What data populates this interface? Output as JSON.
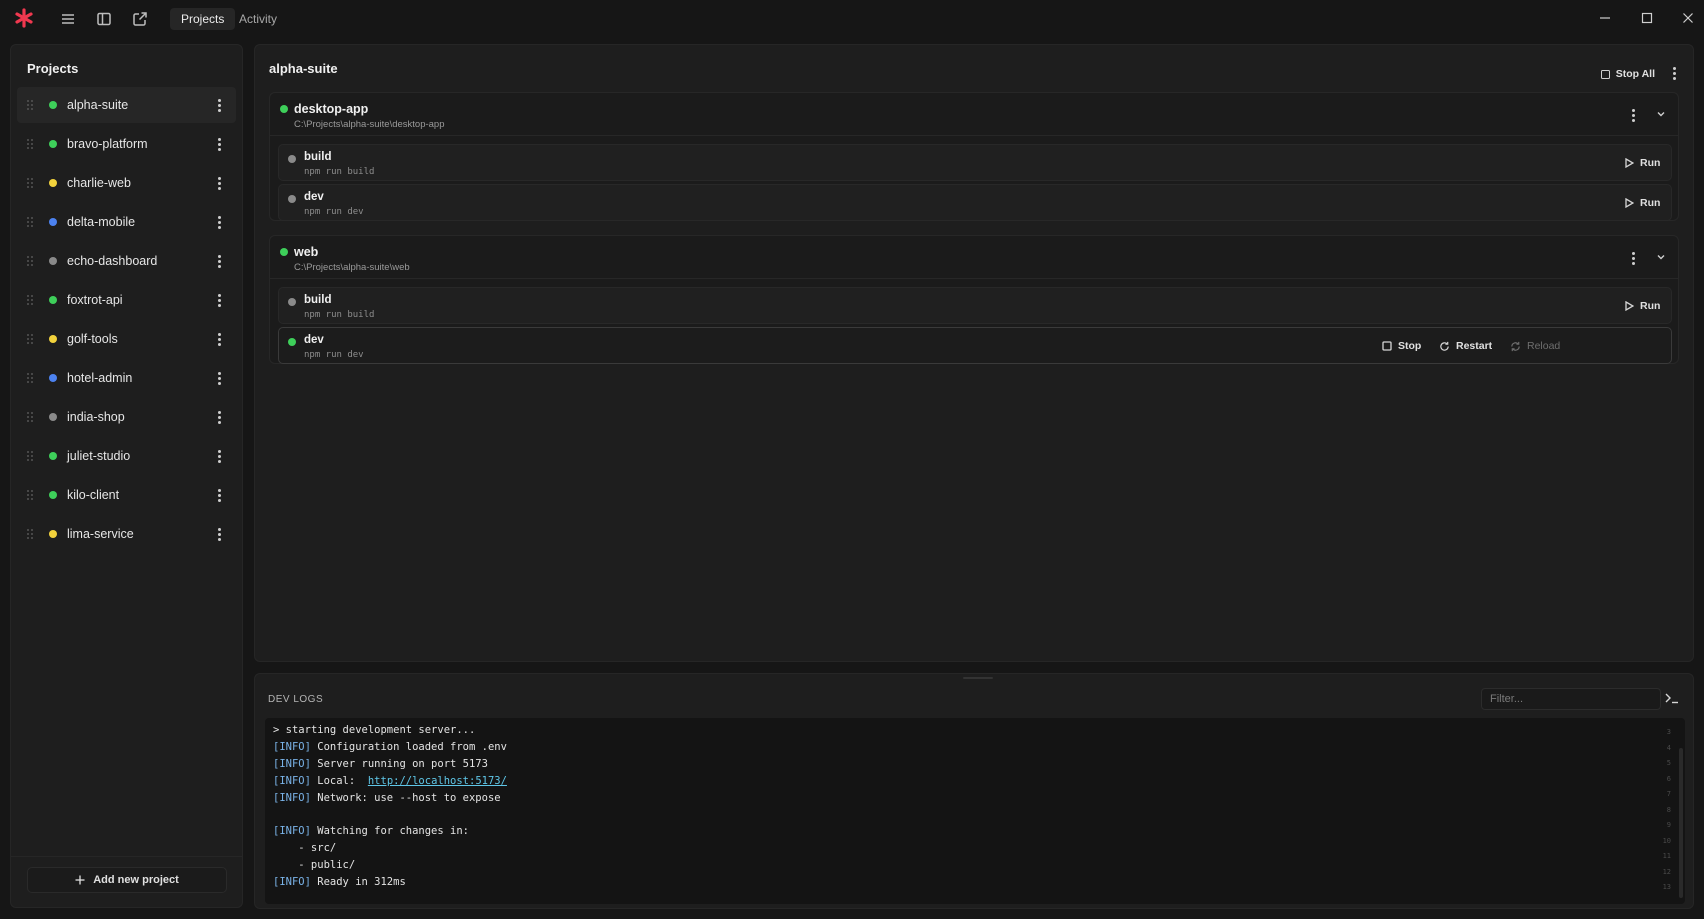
{
  "titlebar": {
    "tabs": [
      {
        "label": "Projects",
        "active": true
      },
      {
        "label": "Activity",
        "active": false
      }
    ],
    "icons": [
      "asterisk-logo-icon",
      "menu-icon",
      "sidebar-toggle-icon",
      "external-link-icon",
      "minimize-icon",
      "maximize-icon",
      "close-icon"
    ]
  },
  "sidebar": {
    "title": "Projects",
    "items": [
      {
        "label": "alpha-suite",
        "status_color": "#3ecf5a",
        "active": true
      },
      {
        "label": "bravo-platform",
        "status_color": "#3ecf5a"
      },
      {
        "label": "charlie-web",
        "status_color": "#f2d23c"
      },
      {
        "label": "delta-mobile",
        "status_color": "#4c82f0"
      },
      {
        "label": "echo-dashboard",
        "status_color": "#8a8a8a"
      },
      {
        "label": "foxtrot-api",
        "status_color": "#3ecf5a"
      },
      {
        "label": "golf-tools",
        "status_color": "#f2d23c"
      },
      {
        "label": "hotel-admin",
        "status_color": "#4c82f0"
      },
      {
        "label": "india-shop",
        "status_color": "#8a8a8a"
      },
      {
        "label": "juliet-studio",
        "status_color": "#3ecf5a"
      },
      {
        "label": "kilo-client",
        "status_color": "#3ecf5a"
      },
      {
        "label": "lima-service",
        "status_color": "#f2d23c"
      }
    ],
    "add_label": "Add new project"
  },
  "main": {
    "title": "alpha-suite",
    "stop_all_label": "Stop All",
    "projects": [
      {
        "name": "desktop-app",
        "path": "C:\\Projects\\alpha-suite\\desktop-app",
        "status_color": "#3ecf5a",
        "scripts": [
          {
            "name": "build",
            "cmd": "npm run build",
            "run_label": "Run",
            "status_color": "#8a8a8a"
          },
          {
            "name": "dev",
            "cmd": "npm run dev",
            "run_label": "Run",
            "status_color": "#8a8a8a"
          }
        ]
      },
      {
        "name": "web",
        "path": "C:\\Projects\\alpha-suite\\web",
        "status_color": "#3ecf5a",
        "scripts": [
          {
            "name": "build",
            "cmd": "npm run build",
            "run_label": "Run",
            "status_color": "#8a8a8a"
          },
          {
            "name": "dev",
            "cmd": "npm run dev",
            "status_color": "#3ecf5a",
            "running": true,
            "stop_label": "Stop",
            "restart_label": "Restart",
            "reload_label": "Reload"
          }
        ]
      }
    ]
  },
  "logs": {
    "title": "DEV LOGS",
    "filter_placeholder": "Filter...",
    "lines": [
      {
        "prompt": ">",
        "text": "starting development server..."
      },
      {
        "tag": "[INFO]",
        "text": "Configuration loaded from .env"
      },
      {
        "tag": "[INFO]",
        "text": "Server running on port 5173"
      },
      {
        "tag": "[INFO]",
        "text": "Local:",
        "link": "http://localhost:5173/"
      },
      {
        "tag": "[INFO]",
        "text": "Network: use --host to expose"
      },
      {
        "text": ""
      },
      {
        "tag": "[INFO]",
        "text": "Watching for changes in:"
      },
      {
        "text": "    - src/"
      },
      {
        "text": "    - public/"
      },
      {
        "tag": "[INFO]",
        "text": "Ready in 312ms"
      }
    ],
    "line_numbers": [
      "3",
      "4",
      "5",
      "6",
      "7",
      "8",
      "9",
      "10",
      "11",
      "12",
      "13"
    ]
  }
}
